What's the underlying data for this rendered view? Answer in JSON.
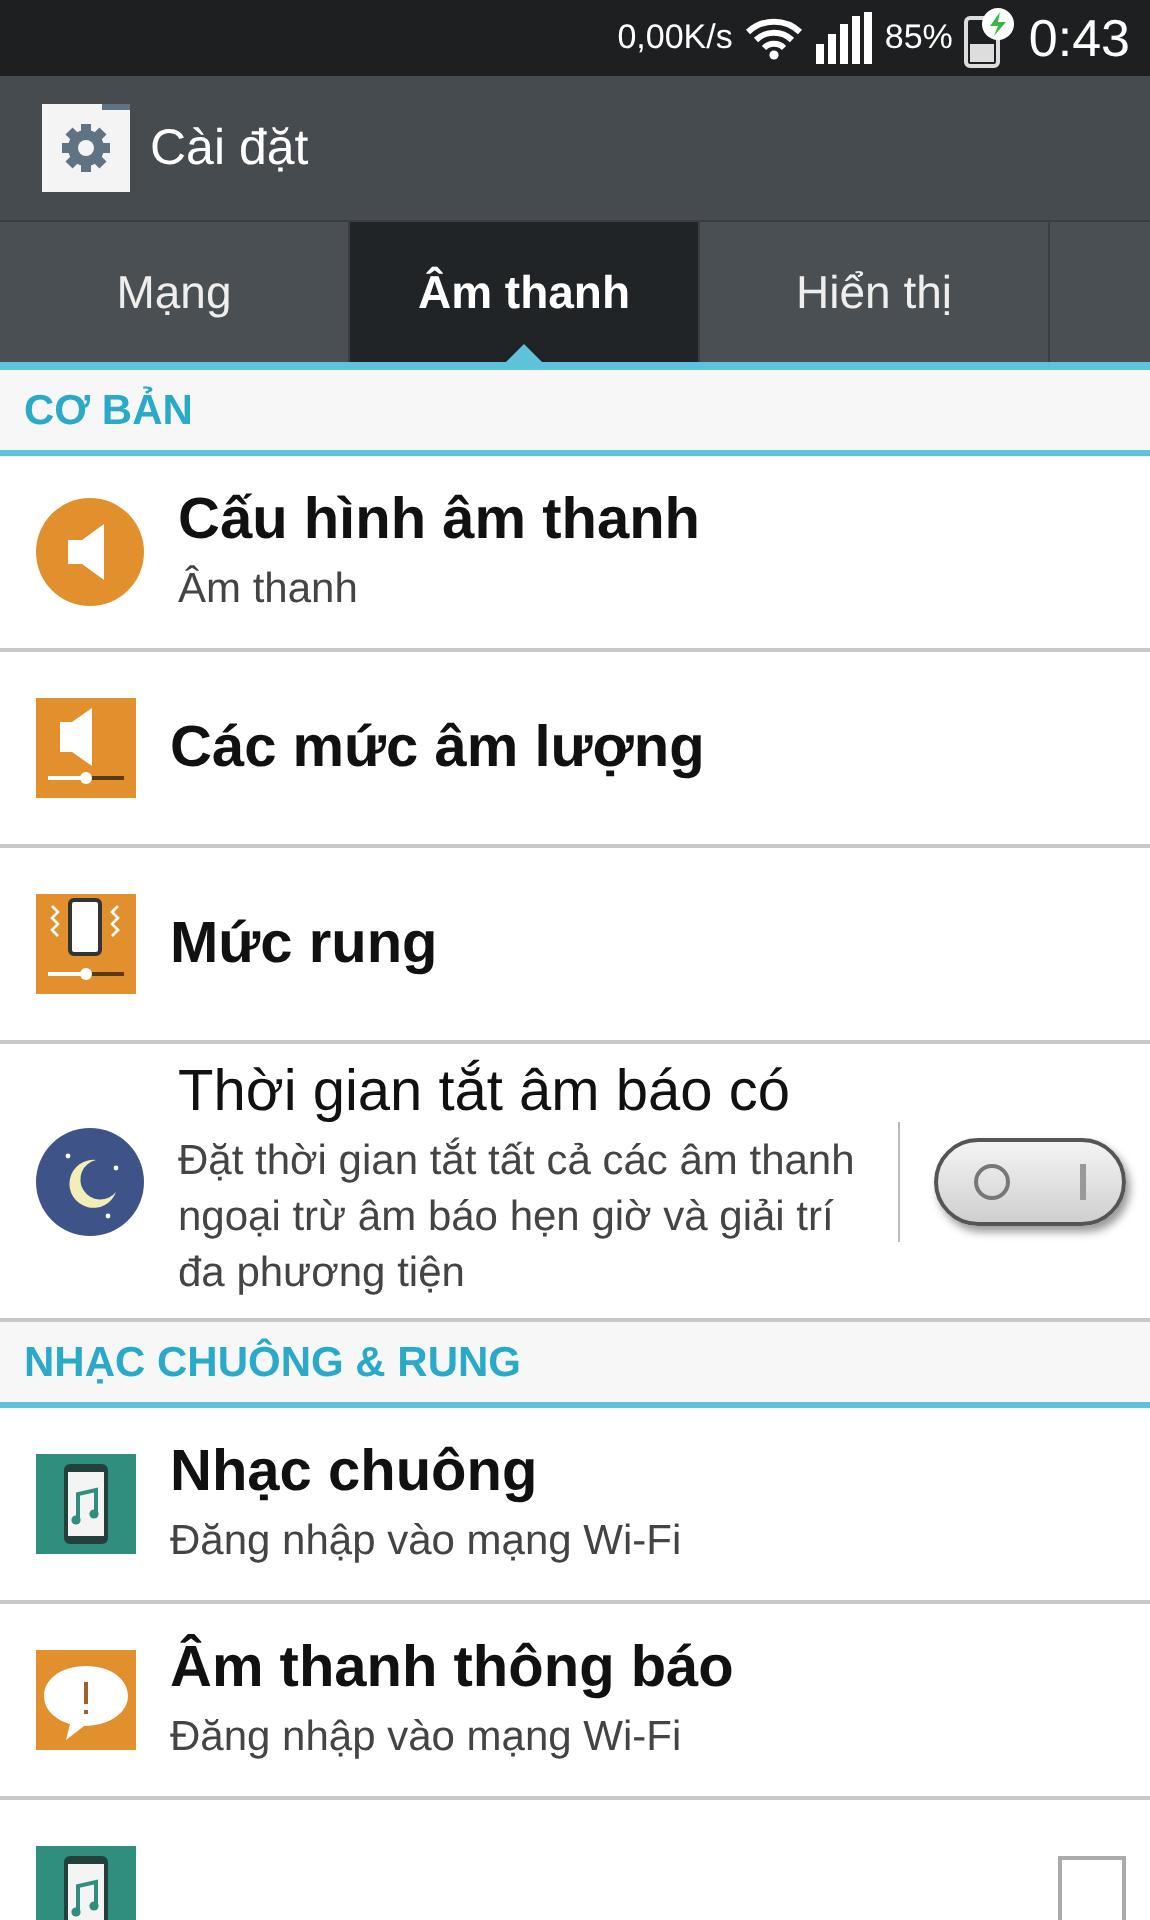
{
  "status_bar": {
    "speed": "0,00K/s",
    "battery": "85%",
    "time": "0:43"
  },
  "app_bar": {
    "title": "Cài đặt"
  },
  "tabs": [
    {
      "label": "Mạng",
      "selected": false
    },
    {
      "label": "Âm thanh",
      "selected": true
    },
    {
      "label": "Hiển thị",
      "selected": false
    }
  ],
  "sections": [
    {
      "header": "CƠ BẢN",
      "items": [
        {
          "kind": "plain",
          "title": "Cấu hình âm thanh",
          "subtitle": "Âm thanh"
        },
        {
          "kind": "plain",
          "title": "Các mức âm lượng"
        },
        {
          "kind": "plain",
          "title": "Mức rung"
        },
        {
          "kind": "toggle",
          "title": "Thời gian tắt âm báo có",
          "subtitle": "Đặt thời gian tắt tất cả các âm thanh ngoại trừ âm báo hẹn giờ và giải trí đa phương tiện",
          "on": false
        }
      ]
    },
    {
      "header": "NHẠC CHUÔNG & RUNG",
      "items": [
        {
          "kind": "plain",
          "title": "Nhạc chuông",
          "subtitle": "Đăng nhập vào mạng Wi-Fi"
        },
        {
          "kind": "plain",
          "title": "Âm thanh thông báo",
          "subtitle": "Đăng nhập vào mạng Wi-Fi"
        },
        {
          "kind": "check",
          "checked": false
        }
      ]
    }
  ]
}
